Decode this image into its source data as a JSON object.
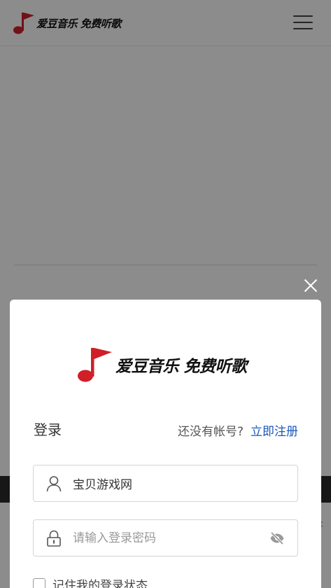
{
  "header": {
    "logo_text": "爱豆音乐 免费听歌"
  },
  "modal": {
    "logo_text": "爱豆音乐 免费听歌",
    "login_title": "登录",
    "register_prompt": "还没有帐号?",
    "register_link": "立即注册",
    "username_value": "宝贝游戏网",
    "password_placeholder": "请输入登录密码",
    "remember_label": "记住我的登录状态"
  },
  "colors": {
    "brand_red": "#d01f28",
    "link_blue": "#1a57b8"
  }
}
